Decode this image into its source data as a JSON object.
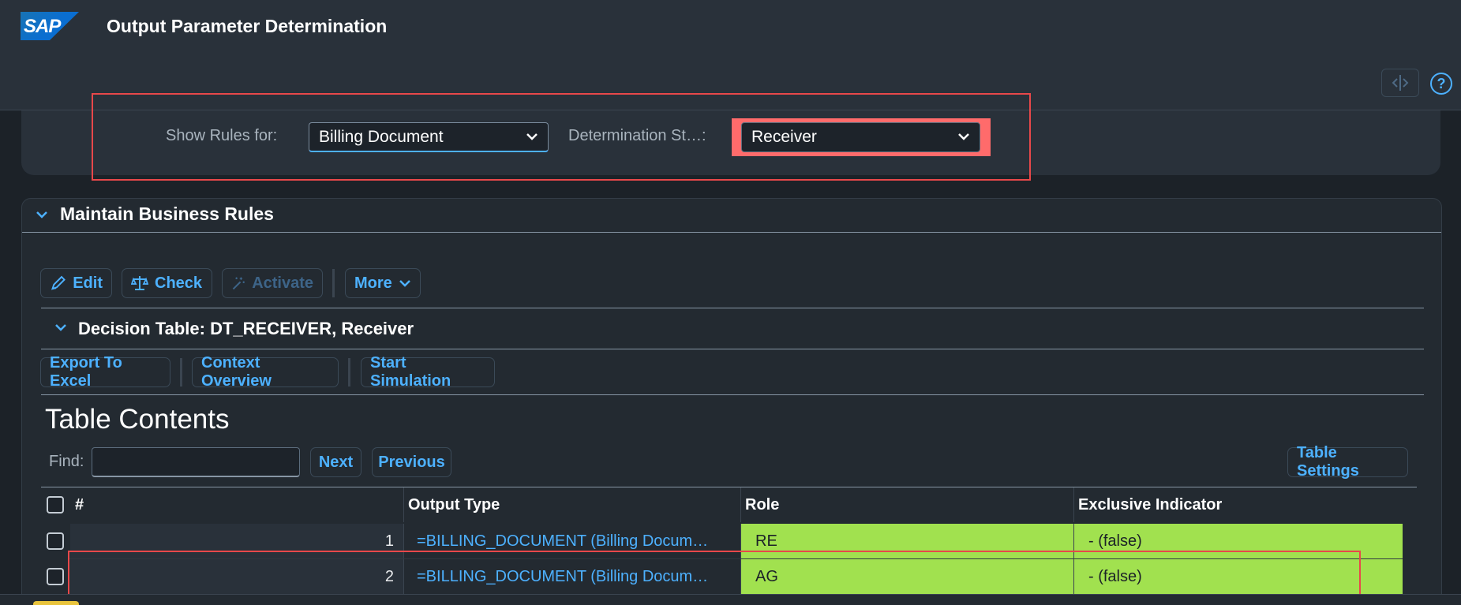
{
  "app": {
    "logo_text": "SAP",
    "title": "Output Parameter Determination"
  },
  "header_actions": {
    "split_icon": "split-view-icon",
    "help_icon": "help-icon",
    "help_glyph": "?"
  },
  "filters": {
    "show_rules_label": "Show Rules for:",
    "show_rules_value": "Billing Document",
    "step_label": "Determination St…:",
    "step_value": "Receiver"
  },
  "section": {
    "title": "Maintain Business Rules",
    "toolbar": {
      "edit": "Edit",
      "check": "Check",
      "activate": "Activate",
      "more": "More"
    }
  },
  "decision_table": {
    "title": "Decision Table: DT_RECEIVER, Receiver",
    "actions": {
      "export": "Export To Excel",
      "context": "Context Overview",
      "simulate": "Start Simulation"
    }
  },
  "table": {
    "title": "Table Contents",
    "find_label": "Find:",
    "find_value": "",
    "next": "Next",
    "previous": "Previous",
    "settings": "Table Settings",
    "columns": [
      "#",
      "Output Type",
      "Role",
      "Exclusive Indicator"
    ],
    "rows": [
      {
        "num": "1",
        "output_type": "=BILLING_DOCUMENT (Billing Docum…",
        "role": "RE",
        "exclusive": "- (false)"
      },
      {
        "num": "2",
        "output_type": "=BILLING_DOCUMENT (Billing Docum…",
        "role": "AG",
        "exclusive": "- (false)"
      }
    ]
  },
  "colors": {
    "accent": "#4db1ff",
    "highlight_cell": "#a1e14f",
    "annotation": "#e8484a"
  }
}
